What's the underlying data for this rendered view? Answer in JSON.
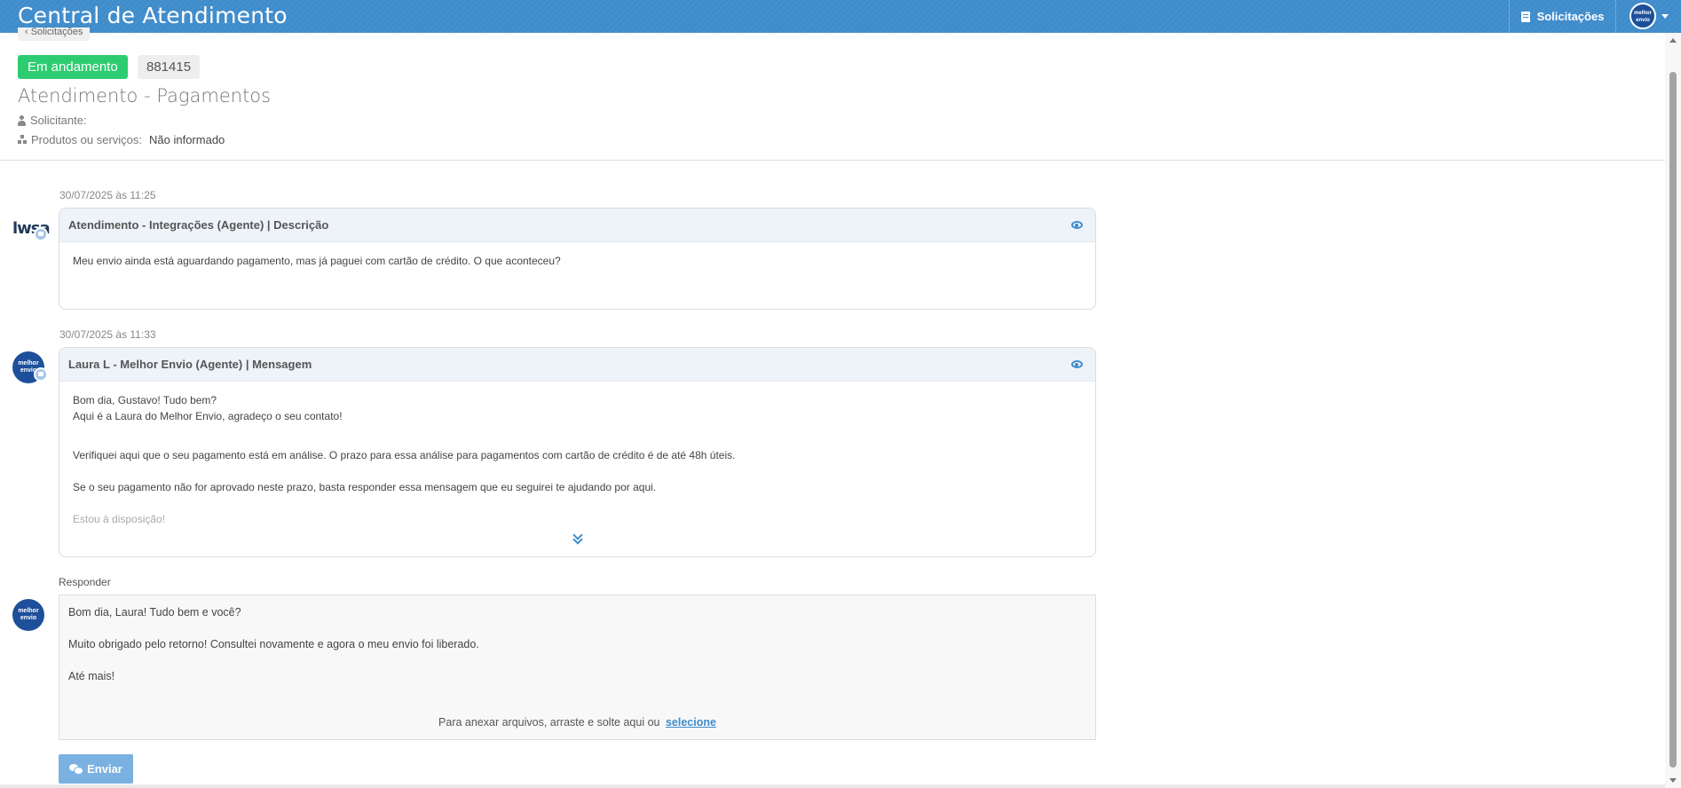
{
  "header": {
    "app_title": "Central de Atendimento",
    "nav_solicitacoes": "Solicitações",
    "avatar_text": "melhor envio"
  },
  "ticket": {
    "back_label": "‹ Solicitações",
    "status": "Em andamento",
    "id": "881415",
    "title": "Atendimento - Pagamentos",
    "requester_label": "Solicitante:",
    "requester_value": "",
    "products_label": "Produtos ou serviços:",
    "products_value": "Não informado"
  },
  "messages": [
    {
      "timestamp": "30/07/2025 às 11:25",
      "avatar_text": "lwsa",
      "header": "Atendimento - Integrações (Agente) | Descrição",
      "body": [
        "Meu envio ainda está aguardando pagamento, mas já paguei com cartão de crédito. O que aconteceu?"
      ]
    },
    {
      "timestamp": "30/07/2025 às 11:33",
      "avatar_text": "melhor envio",
      "header": "Laura L - Melhor Envio (Agente) | Mensagem",
      "body": [
        "Bom dia, Gustavo! Tudo bem?",
        "Aqui é a Laura do Melhor Envio, agradeço o seu contato!",
        "Verifiquei aqui que o seu pagamento está em análise. O prazo para essa análise para pagamentos com cartão de crédito é de até 48h úteis.",
        "Se o seu pagamento não for aprovado neste prazo, basta responder essa mensagem que eu seguirei te ajudando por aqui.",
        "Estou à disposição!"
      ]
    }
  ],
  "reply": {
    "label": "Responder",
    "avatar_text": "melhor envio",
    "lines": [
      "Bom dia, Laura! Tudo bem e você?",
      "Muito obrigado pelo retorno! Consultei novamente e agora o meu envio foi liberado.",
      "Até mais!"
    ],
    "attach_text": "Para anexar arquivos, arraste e solte aqui ou",
    "attach_link": "selecione",
    "send_label": "Enviar"
  },
  "colors": {
    "brand": "#3f8ccb",
    "status_green": "#2ecc71",
    "send_button": "#7bb1e0"
  }
}
